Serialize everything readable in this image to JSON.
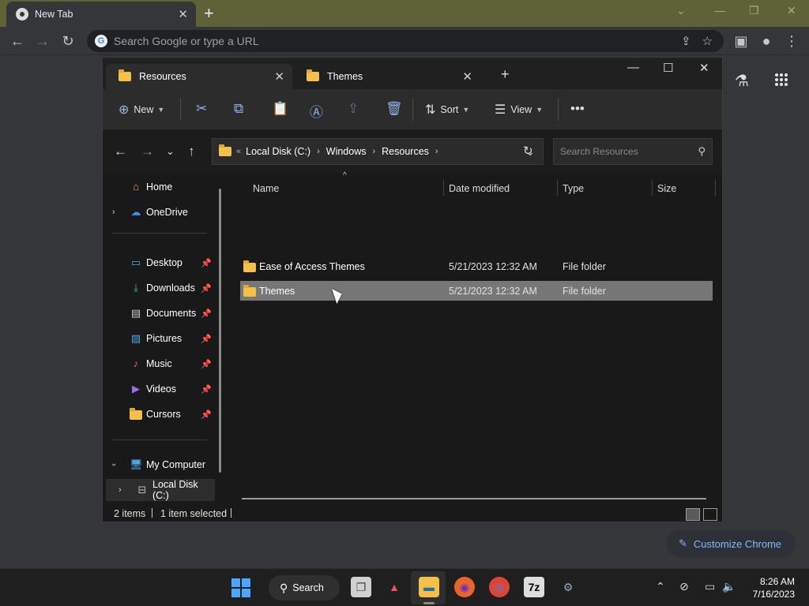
{
  "chrome": {
    "tab_title": "New Tab",
    "omnibox_placeholder": "Search Google or type a URL",
    "customize_label": "Customize Chrome"
  },
  "explorer": {
    "tabs": [
      {
        "label": "Resources",
        "active": true
      },
      {
        "label": "Themes",
        "active": false
      }
    ],
    "commands": {
      "new_label": "New",
      "sort_label": "Sort",
      "view_label": "View"
    },
    "breadcrumb": [
      "Local Disk (C:)",
      "Windows",
      "Resources"
    ],
    "search_placeholder": "Search Resources",
    "nav": {
      "home": "Home",
      "onedrive": "OneDrive",
      "quick_access": [
        "Desktop",
        "Downloads",
        "Documents",
        "Pictures",
        "Music",
        "Videos",
        "Cursors"
      ],
      "my_computer": "My Computer",
      "local_disk": "Local Disk (C:)"
    },
    "columns": {
      "name": "Name",
      "date": "Date modified",
      "type": "Type",
      "size": "Size"
    },
    "rows": [
      {
        "name": "Ease of Access Themes",
        "date": "5/21/2023 12:32 AM",
        "type": "File folder",
        "size": ""
      },
      {
        "name": "Themes",
        "date": "5/21/2023 12:32 AM",
        "type": "File folder",
        "size": ""
      }
    ],
    "status": {
      "count": "2 items",
      "selected": "1 item selected"
    }
  },
  "taskbar": {
    "search_label": "Search",
    "time": "8:26 AM",
    "date": "7/16/2023"
  },
  "icons": {
    "chrome_tab": "chrome-logo-icon",
    "folder": "folder-icon",
    "home": "home-icon",
    "onedrive": "cloud-icon"
  },
  "colors": {
    "chrome_frame": "#5f6236",
    "selection": "#777777",
    "folder": "#f3c04a",
    "accent": "#8ab4f8"
  }
}
